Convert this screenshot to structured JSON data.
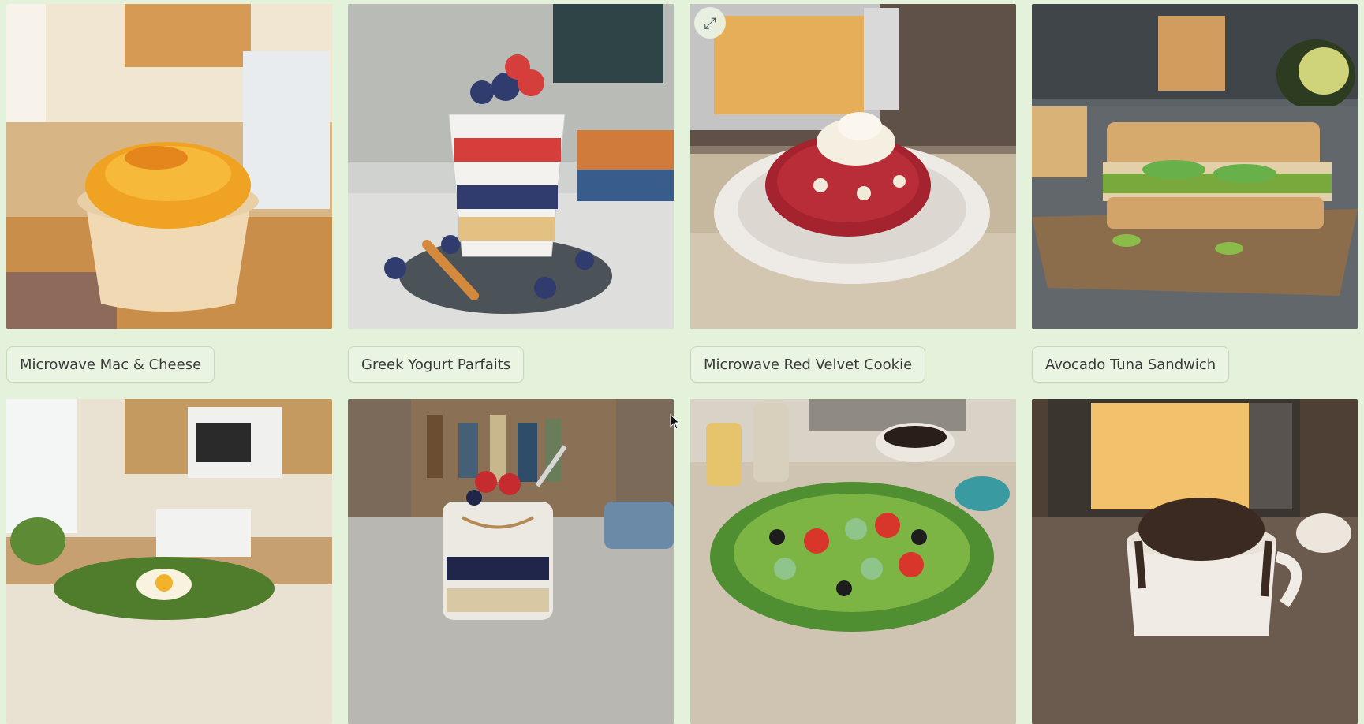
{
  "recipes": [
    {
      "name": "Microwave Mac & Cheese",
      "image_alt": "Bowl of mac and cheese in dorm kitchen"
    },
    {
      "name": "Greek Yogurt Parfaits",
      "image_alt": "Layered yogurt parfait with berries and granola"
    },
    {
      "name": "Microwave Red Velvet Cookie",
      "image_alt": "Red velvet cookie on plate near microwave"
    },
    {
      "name": "Avocado Tuna Sandwich",
      "image_alt": "Tuna avocado sandwich on cutting board"
    },
    {
      "name": "",
      "image_alt": "Egg and spinach bowl in kitchen"
    },
    {
      "name": "",
      "image_alt": "Overnight oats in jar with berries"
    },
    {
      "name": "",
      "image_alt": "Greek salad bowl"
    },
    {
      "name": "",
      "image_alt": "Chocolate mug cake near microwave"
    }
  ],
  "colors": {
    "background": "#e4f2dc",
    "label_bg": "#e9f4e3",
    "label_border": "#c6d8bd"
  },
  "icons": {
    "expand": "expand-icon",
    "cursor": "mouse-cursor-icon"
  }
}
